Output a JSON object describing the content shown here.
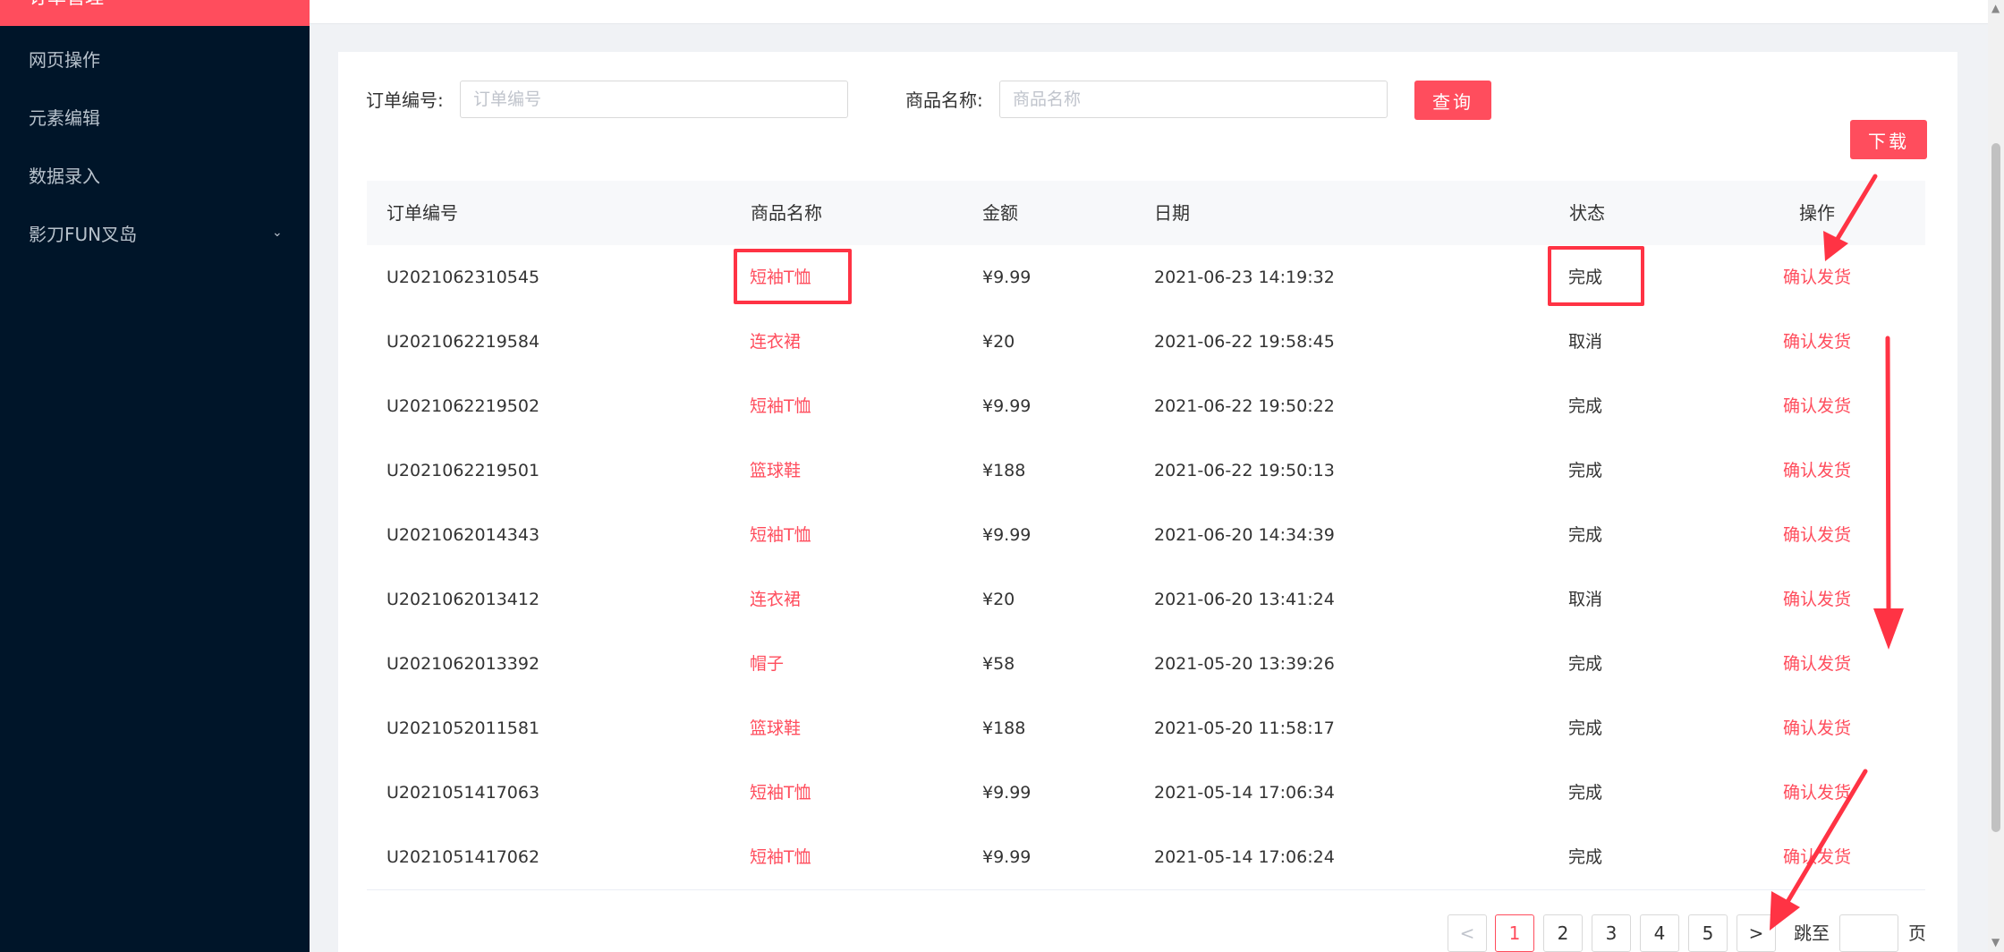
{
  "sidebar": {
    "active": "订单管理",
    "items": [
      {
        "label": "网页操作"
      },
      {
        "label": "元素编辑"
      },
      {
        "label": "数据录入"
      },
      {
        "label": "影刀FUN叉岛",
        "chevron": "⌄"
      }
    ]
  },
  "search": {
    "order_label": "订单编号:",
    "order_placeholder": "订单编号",
    "product_label": "商品名称:",
    "product_placeholder": "商品名称",
    "query_button": "查询",
    "download_button": "下载"
  },
  "table": {
    "headers": [
      "订单编号",
      "商品名称",
      "金额",
      "日期",
      "状态",
      "操作"
    ],
    "rows": [
      {
        "id": "U2021062310545",
        "product": "短袖T恤",
        "amount": "¥9.99",
        "date": "2021-06-23 14:19:32",
        "status": "完成",
        "action": "确认发货"
      },
      {
        "id": "U2021062219584",
        "product": "连衣裙",
        "amount": "¥20",
        "date": "2021-06-22 19:58:45",
        "status": "取消",
        "action": "确认发货"
      },
      {
        "id": "U2021062219502",
        "product": "短袖T恤",
        "amount": "¥9.99",
        "date": "2021-06-22 19:50:22",
        "status": "完成",
        "action": "确认发货"
      },
      {
        "id": "U2021062219501",
        "product": "篮球鞋",
        "amount": "¥188",
        "date": "2021-06-22 19:50:13",
        "status": "完成",
        "action": "确认发货"
      },
      {
        "id": "U2021062014343",
        "product": "短袖T恤",
        "amount": "¥9.99",
        "date": "2021-06-20 14:34:39",
        "status": "完成",
        "action": "确认发货"
      },
      {
        "id": "U2021062013412",
        "product": "连衣裙",
        "amount": "¥20",
        "date": "2021-06-20 13:41:24",
        "status": "取消",
        "action": "确认发货"
      },
      {
        "id": "U2021062013392",
        "product": "帽子",
        "amount": "¥58",
        "date": "2021-05-20 13:39:26",
        "status": "完成",
        "action": "确认发货"
      },
      {
        "id": "U2021052011581",
        "product": "篮球鞋",
        "amount": "¥188",
        "date": "2021-05-20 11:58:17",
        "status": "完成",
        "action": "确认发货"
      },
      {
        "id": "U2021051417063",
        "product": "短袖T恤",
        "amount": "¥9.99",
        "date": "2021-05-14 17:06:34",
        "status": "完成",
        "action": "确认发货"
      },
      {
        "id": "U2021051417062",
        "product": "短袖T恤",
        "amount": "¥9.99",
        "date": "2021-05-14 17:06:24",
        "status": "完成",
        "action": "确认发货"
      }
    ]
  },
  "pagination": {
    "prev": "<",
    "pages": [
      "1",
      "2",
      "3",
      "4",
      "5"
    ],
    "current": "1",
    "next": ">",
    "jump_label": "跳至",
    "page_suffix": "页"
  },
  "colors": {
    "accent": "#ff4d5d",
    "sidebar_bg": "#001529",
    "annotation": "#ff3344"
  }
}
